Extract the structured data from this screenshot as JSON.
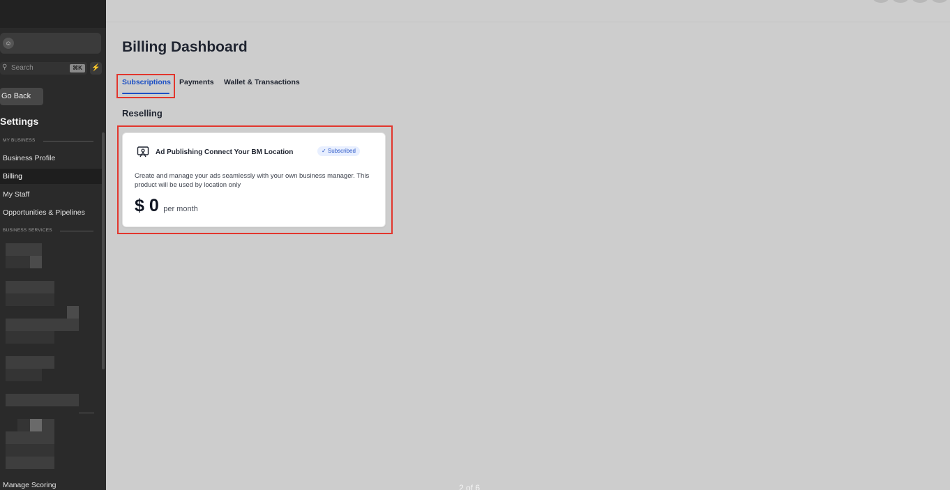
{
  "sidebar": {
    "search": {
      "placeholder": "Search",
      "shortcut": "⌘K"
    },
    "go_back": "Go Back",
    "settings_title": "Settings",
    "sections": {
      "my_business": "MY BUSINESS",
      "business_services": "BUSINESS SERVICES"
    },
    "items": {
      "business_profile": "Business Profile",
      "billing": "Billing",
      "my_staff": "My Staff",
      "opportunities": "Opportunities & Pipelines",
      "manage_scoring": "Manage Scoring"
    }
  },
  "main": {
    "title": "Billing Dashboard",
    "tabs": [
      "Subscriptions",
      "Payments",
      "Wallet & Transactions"
    ],
    "active_tab": "Subscriptions",
    "section_title": "Reselling",
    "card": {
      "title": "Ad Publishing Connect Your BM Location",
      "badge": "✓ Subscribed",
      "description": "Create and manage your ads seamlessly with your own business manager. This product will be used by location only",
      "price": "$ 0",
      "period": "per month"
    }
  },
  "pager": "2 of 6",
  "colors": {
    "accent": "#1c4fc4",
    "highlight": "#e2362d",
    "sidebar_bg": "#2a2a2a",
    "main_bg": "#cdcdcd"
  }
}
